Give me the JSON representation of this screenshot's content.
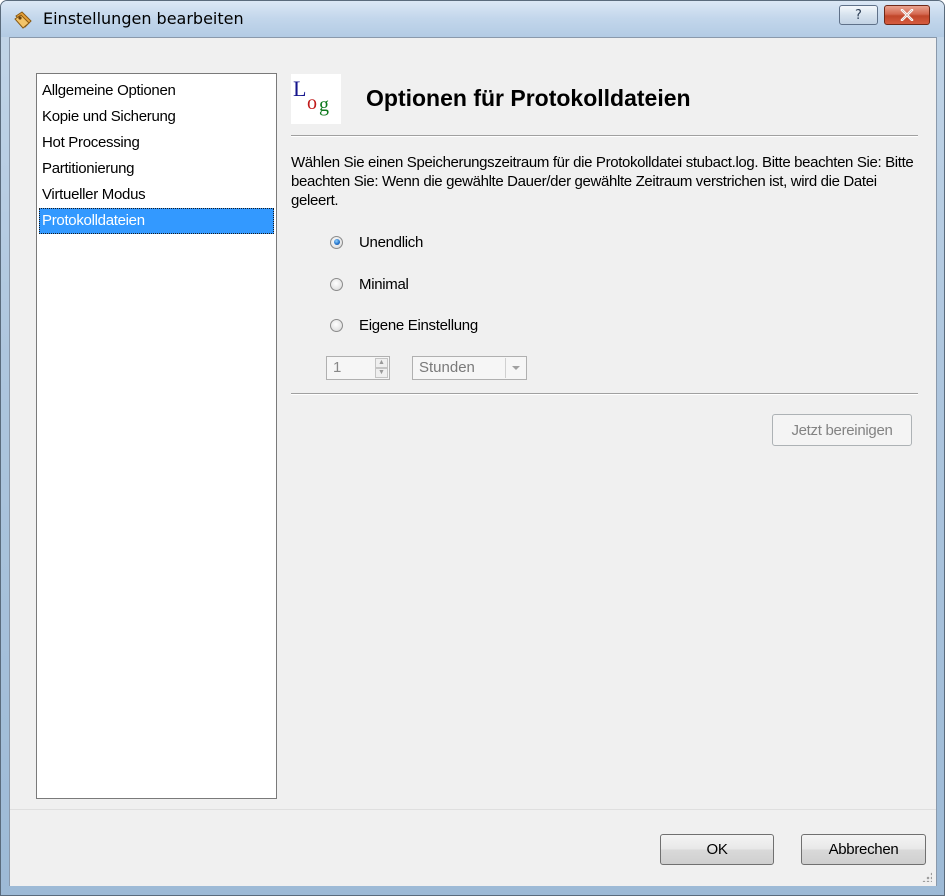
{
  "window": {
    "title": "Einstellungen bearbeiten",
    "help_label": "?",
    "close_label": "✕"
  },
  "sidebar": {
    "items": [
      {
        "label": "Allgemeine Optionen",
        "selected": false
      },
      {
        "label": "Kopie und Sicherung",
        "selected": false
      },
      {
        "label": "Hot Processing",
        "selected": false
      },
      {
        "label": "Partitionierung",
        "selected": false
      },
      {
        "label": "Virtueller Modus",
        "selected": false
      },
      {
        "label": "Protokolldateien",
        "selected": true
      }
    ]
  },
  "panel": {
    "icon": {
      "name": "log-icon",
      "L": "L",
      "o": "o",
      "g": "g"
    },
    "title": "Optionen für Protokolldateien",
    "description": "Wählen Sie einen Speicherungszeitraum für die Protokolldatei stubact.log. Bitte beachten Sie: Bitte beachten Sie: Wenn die gewählte Dauer/der gewählte Zeitraum verstrichen ist, wird die Datei geleert.",
    "options": [
      {
        "label": "Unendlich",
        "checked": true
      },
      {
        "label": "Minimal",
        "checked": false
      },
      {
        "label": "Eigene Einstellung",
        "checked": false
      }
    ],
    "duration_value": "1",
    "duration_unit": "Stunden",
    "cleanup_label": "Jetzt bereinigen"
  },
  "footer": {
    "ok_label": "OK",
    "cancel_label": "Abbrechen"
  }
}
